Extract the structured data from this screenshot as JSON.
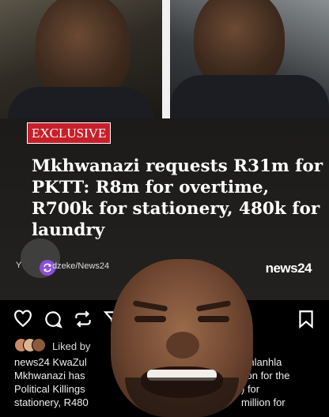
{
  "post": {
    "badge": "EXCLUSIVE",
    "headline": "Mkhwanazi requests R31m for PKTT: R8m for overtime, R700k for stationery, 480k for laundry",
    "credit_prefix": "Y",
    "credit_suffix": "dzeke/News24",
    "brand": "news24"
  },
  "actions": {
    "like": "heart-icon",
    "comment": "comment-icon",
    "repost": "repost-icon",
    "share": "send-icon",
    "save": "bookmark-icon"
  },
  "liked_by": {
    "text": "Liked by"
  },
  "caption": {
    "left_lines": [
      "news24 KwaZul",
      "Mkhwanazi has",
      "Political Killings",
      "stationery, R480"
    ],
    "right_lines": [
      "Nhlanhla",
      "tion for the",
      ") for",
      "million for"
    ]
  },
  "colors": {
    "badge_red": "#c8202a",
    "sync_purple": "#8a4fd8"
  }
}
